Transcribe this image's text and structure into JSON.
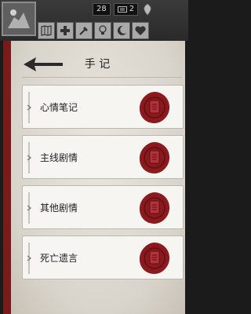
{
  "header": {
    "stat_value_1": "28",
    "stat_value_2": "2"
  },
  "toolbar": {
    "icons": [
      "map-icon",
      "medical-cross-icon",
      "crafting-icon",
      "lightbulb-icon",
      "moon-icon",
      "heart-icon"
    ]
  },
  "journal": {
    "title": "手 记",
    "entries": [
      {
        "label": "心情笔记"
      },
      {
        "label": "主线剧情"
      },
      {
        "label": "其他剧情"
      },
      {
        "label": "死亡遗言"
      }
    ]
  },
  "colors": {
    "spine": "#7a1b1b",
    "seal": "#8b1a1f",
    "paper": "#e9e5de"
  }
}
